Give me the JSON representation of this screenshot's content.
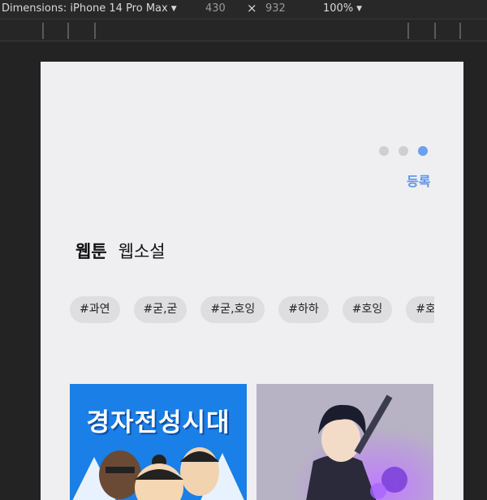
{
  "devtools": {
    "device_label": "Dimensions: iPhone 14 Pro Max",
    "width": "430",
    "times": "×",
    "height": "932",
    "zoom": "100%"
  },
  "carousel": {
    "dot_count": 3,
    "active_index": 2
  },
  "register_label": "등록",
  "tabs": [
    {
      "label": "웹툰",
      "active": true
    },
    {
      "label": "웹소설",
      "active": false
    }
  ],
  "tags": [
    "#과연",
    "#굳,굳",
    "#굳,호잉",
    "#하하",
    "#호잉",
    "#호잉"
  ],
  "cards": [
    {
      "title": "경자전성시대"
    },
    {
      "title": ""
    }
  ],
  "colors": {
    "accent": "#5f95e6",
    "active_dot": "#6aa0f0",
    "card1_bg": "#1a7fe6",
    "card2_bg": "#b7b3c4"
  }
}
